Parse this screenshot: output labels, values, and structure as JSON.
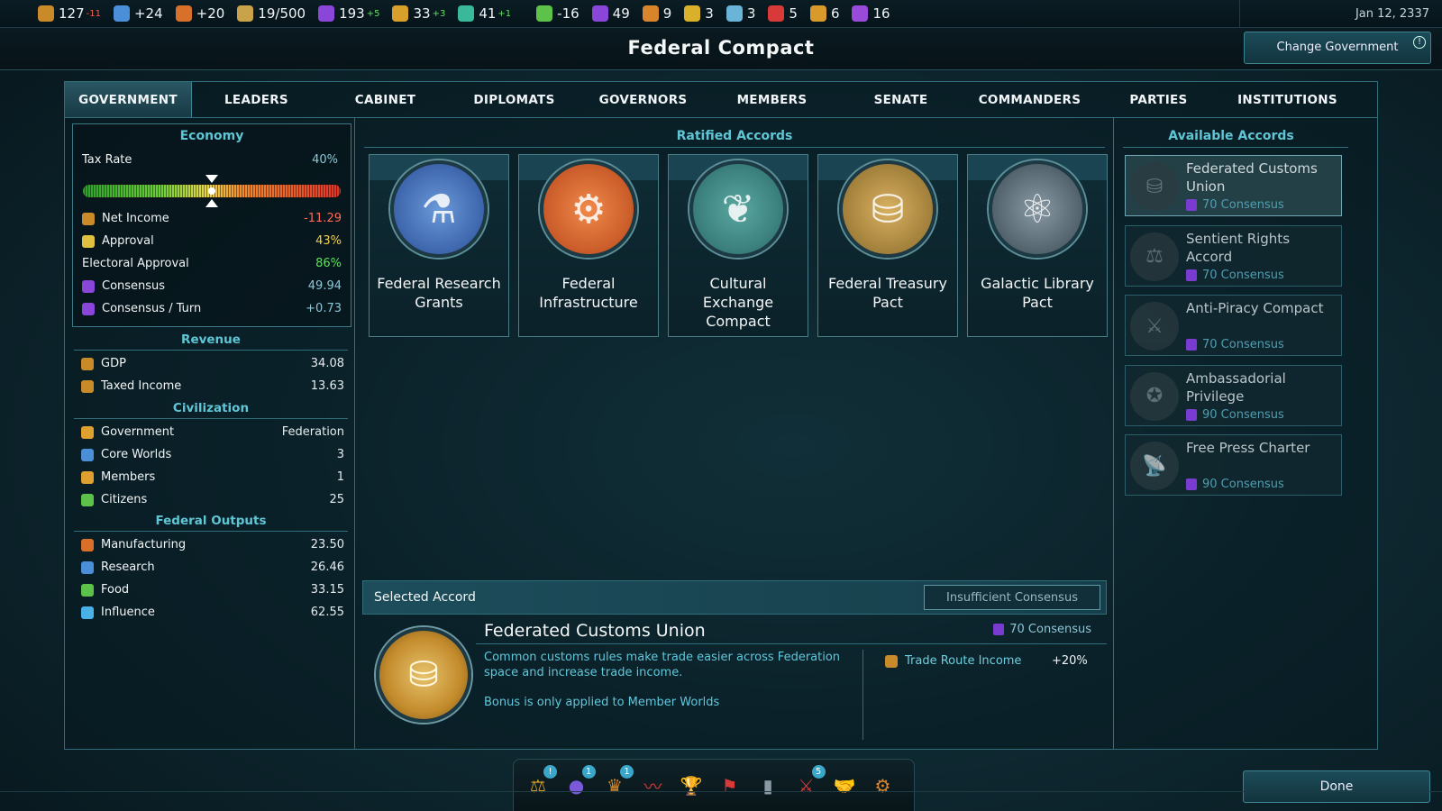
{
  "resources": [
    {
      "icon": "influence-coin-icon",
      "color": "#c98a2a",
      "value": "127",
      "delta": "-11",
      "delta_type": "neg"
    },
    {
      "icon": "research-flask-icon",
      "color": "#4a8fd8",
      "value": "+24",
      "delta": "",
      "delta_type": ""
    },
    {
      "icon": "manufacturing-hammer-icon",
      "color": "#d8702a",
      "value": "+20",
      "delta": "",
      "delta_type": ""
    },
    {
      "icon": "cargo-crate-icon",
      "color": "#c9a24a",
      "value": "19/500",
      "delta": "",
      "delta_type": ""
    },
    {
      "icon": "consensus-icon",
      "color": "#8a46d8",
      "value": "193",
      "delta": "+5",
      "delta_type": "pos"
    },
    {
      "icon": "justice-scales-icon",
      "color": "#d8a02a",
      "value": "33",
      "delta": "+3",
      "delta_type": "pos"
    },
    {
      "icon": "population-icon",
      "color": "#3ab89a",
      "value": "41",
      "delta": "+1",
      "delta_type": "pos"
    },
    {
      "icon": "food-apple-icon",
      "color": "#5cc24a",
      "value": "-16",
      "delta": "",
      "delta_type": ""
    },
    {
      "icon": "consensus-stack-icon",
      "color": "#8a46d8",
      "value": "49",
      "delta": "",
      "delta_type": ""
    },
    {
      "icon": "credits-icon",
      "color": "#d8842a",
      "value": "9",
      "delta": "",
      "delta_type": ""
    },
    {
      "icon": "document-icon",
      "color": "#d8b02a",
      "value": "3",
      "delta": "",
      "delta_type": ""
    },
    {
      "icon": "crystal-icon",
      "color": "#6ab4d8",
      "value": "3",
      "delta": "",
      "delta_type": ""
    },
    {
      "icon": "medical-icon",
      "color": "#d83a3a",
      "value": "5",
      "delta": "",
      "delta_type": ""
    },
    {
      "icon": "gear-resource-icon",
      "color": "#d89a2a",
      "value": "6",
      "delta": "",
      "delta_type": ""
    },
    {
      "icon": "psionic-icon",
      "color": "#9a4ad8",
      "value": "16",
      "delta": "",
      "delta_type": ""
    }
  ],
  "date": "Jan 12, 2337",
  "title": "Federal Compact",
  "change_government": "Change Government",
  "tabs": [
    "GOVERNMENT",
    "LEADERS",
    "CABINET",
    "DIPLOMATS",
    "GOVERNORS",
    "MEMBERS",
    "SENATE",
    "COMMANDERS",
    "PARTIES",
    "INSTITUTIONS"
  ],
  "economy": {
    "title": "Economy",
    "tax_label": "Tax Rate",
    "tax_value": "40%",
    "tax_fraction": 0.5,
    "rows": [
      {
        "label": "Net Income",
        "value": "-11.29",
        "icon": "influence-coin-icon",
        "color": "#c98a2a",
        "value_color": "#ff6a5a"
      },
      {
        "label": "Approval",
        "value": "43%",
        "icon": "approval-face-icon",
        "color": "#e0c040",
        "value_color": "#f2d04a"
      },
      {
        "label": "Electoral Approval",
        "value": "86%",
        "icon": "",
        "color": "",
        "value_color": "#5fe05f"
      },
      {
        "label": "Consensus",
        "value": "49.94",
        "icon": "consensus-icon",
        "color": "#8a46d8",
        "value_color": "#8ec6d6"
      },
      {
        "label": "Consensus / Turn",
        "value": "+0.73",
        "icon": "consensus-icon",
        "color": "#8a46d8",
        "value_color": "#8ec6d6"
      }
    ]
  },
  "revenue": {
    "title": "Revenue",
    "rows": [
      {
        "label": "GDP",
        "value": "34.08",
        "icon": "influence-coin-icon",
        "color": "#c98a2a"
      },
      {
        "label": "Taxed Income",
        "value": "13.63",
        "icon": "influence-coin-icon",
        "color": "#c98a2a"
      }
    ]
  },
  "civilization": {
    "title": "Civilization",
    "rows": [
      {
        "label": "Government",
        "value": "Federation",
        "icon": "government-icon",
        "color": "#e0a030"
      },
      {
        "label": "Core Worlds",
        "value": "3",
        "icon": "planet-icon",
        "color": "#4a8fd8"
      },
      {
        "label": "Members",
        "value": "1",
        "icon": "member-icon",
        "color": "#e0a030"
      },
      {
        "label": "Citizens",
        "value": "25",
        "icon": "citizen-icon",
        "color": "#5cc24a"
      }
    ]
  },
  "federal_outputs": {
    "title": "Federal Outputs",
    "rows": [
      {
        "label": "Manufacturing",
        "value": "23.50",
        "icon": "manufacturing-hammer-icon",
        "color": "#d8702a"
      },
      {
        "label": "Research",
        "value": "26.46",
        "icon": "research-flask-icon",
        "color": "#4a8fd8"
      },
      {
        "label": "Food",
        "value": "33.15",
        "icon": "food-apple-icon",
        "color": "#5cc24a"
      },
      {
        "label": "Influence",
        "value": "62.55",
        "icon": "influence-icon",
        "color": "#4ab0e8"
      }
    ]
  },
  "ratified": {
    "title": "Ratified Accords",
    "accords": [
      {
        "name": "Federal Research Grants",
        "icon": "research-flask-icon",
        "glyph": "⚗",
        "color_a": "#6a9ad8",
        "color_b": "#2a4e9a"
      },
      {
        "name": "Federal Infrastructure",
        "icon": "crossed-beams-gear-icon",
        "glyph": "⚙",
        "color_a": "#f08a4a",
        "color_b": "#b8461a"
      },
      {
        "name": "Cultural Exchange Compact",
        "icon": "handshake-wreath-icon",
        "glyph": "❦",
        "color_a": "#5aa8a0",
        "color_b": "#2a6a6a"
      },
      {
        "name": "Federal Treasury Pact",
        "icon": "vault-coins-icon",
        "glyph": "⛁",
        "color_a": "#d8b060",
        "color_b": "#8a6a2a"
      },
      {
        "name": "Galactic Library Pact",
        "icon": "atom-book-icon",
        "glyph": "⚛",
        "color_a": "#8a9aa4",
        "color_b": "#3a4a54"
      }
    ]
  },
  "selected": {
    "label": "Selected Accord",
    "status": "Insufficient Consensus",
    "name": "Federated Customs Union",
    "cost": "70 Consensus",
    "description": "Common customs rules make trade easier across Federation space and increase trade income.",
    "note": "Bonus is only applied to Member Worlds",
    "bonus_label": "Trade Route Income",
    "bonus_value": "+20%",
    "icon": "customs-coins-icon"
  },
  "available": {
    "title": "Available Accords",
    "accords": [
      {
        "name": "Federated Customs Union",
        "cost": "70 Consensus",
        "icon": "customs-coins-icon",
        "glyph": "⛁"
      },
      {
        "name": "Sentient Rights Accord",
        "cost": "70 Consensus",
        "icon": "justice-scales-icon",
        "glyph": "⚖"
      },
      {
        "name": "Anti-Piracy Compact",
        "cost": "70 Consensus",
        "icon": "crossed-swords-icon",
        "glyph": "⚔"
      },
      {
        "name": "Ambassadorial Privilege",
        "cost": "90 Consensus",
        "icon": "diplomat-seal-icon",
        "glyph": "✪"
      },
      {
        "name": "Free Press Charter",
        "cost": "90 Consensus",
        "icon": "broadcast-dish-icon",
        "glyph": "📡"
      }
    ]
  },
  "dock": [
    {
      "icon": "justice-scales-icon",
      "glyph": "⚖",
      "badge": "!",
      "color": "#d8a02a"
    },
    {
      "icon": "planet-icon",
      "glyph": "●",
      "badge": "1",
      "color": "#7a5ad8"
    },
    {
      "icon": "crown-icon",
      "glyph": "♛",
      "badge": "1",
      "color": "#d88a2a"
    },
    {
      "icon": "economy-chart-icon",
      "glyph": "〰",
      "badge": "",
      "color": "#d83a3a"
    },
    {
      "icon": "trophy-icon",
      "glyph": "🏆",
      "badge": "",
      "color": "#9aa4a8"
    },
    {
      "icon": "flag-icon",
      "glyph": "⚑",
      "badge": "",
      "color": "#d83a3a"
    },
    {
      "icon": "monument-icon",
      "glyph": "▮",
      "badge": "",
      "color": "#8a9aa4"
    },
    {
      "icon": "military-icon",
      "glyph": "⚔",
      "badge": "5",
      "color": "#d83a3a"
    },
    {
      "icon": "diplomacy-handshake-icon",
      "glyph": "🤝",
      "badge": "",
      "color": "#d8a02a"
    },
    {
      "icon": "government-gear-icon",
      "glyph": "⚙",
      "badge": "",
      "color": "#d8842a"
    }
  ],
  "done": "Done"
}
